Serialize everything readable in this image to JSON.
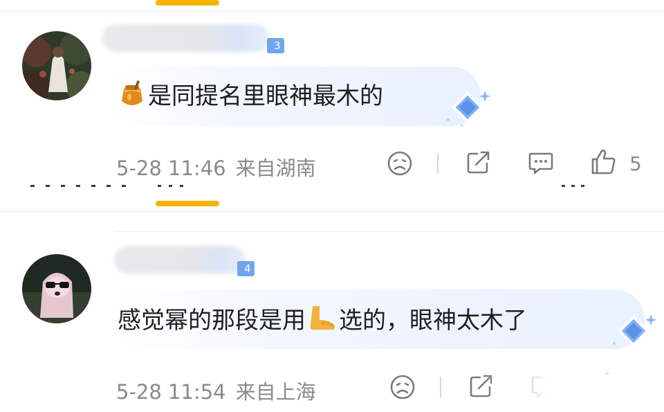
{
  "comments": [
    {
      "level": "3",
      "text": "是同提名里眼神最木的",
      "inline_emoji": "honey-pot",
      "time": "5-28 11:46",
      "location": "来自湖南",
      "likes": "5"
    },
    {
      "level": "4",
      "text_before": "感觉幂的那段是用",
      "inline_emoji": "foot",
      "text_after": "选的，眼神太木了",
      "time": "5-28 11:54",
      "location": "来自上海"
    }
  ],
  "colors": {
    "accent": "#f4b400",
    "badge": "#6fa5ef",
    "meta_text": "#8a8a8a"
  }
}
